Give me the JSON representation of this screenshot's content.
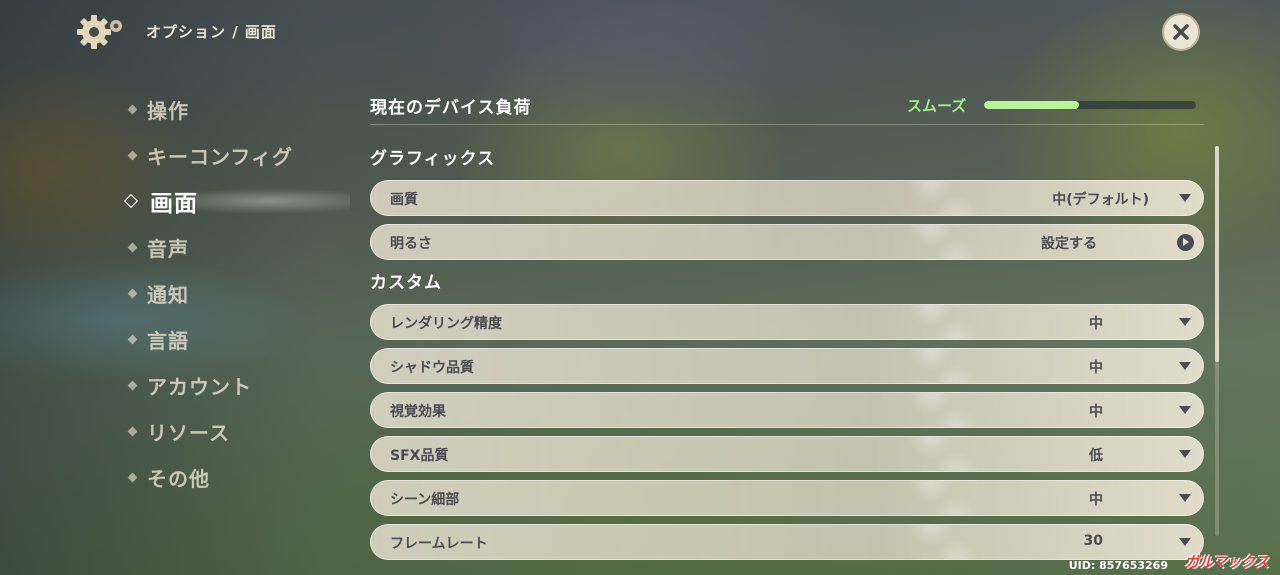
{
  "header": {
    "breadcrumb": "オプション / 画面",
    "gear_icon": "gear-icon",
    "close_icon": "close-icon"
  },
  "sidebar": {
    "items": [
      {
        "label": "操作",
        "active": false
      },
      {
        "label": "キーコンフィグ",
        "active": false
      },
      {
        "label": "画面",
        "active": true
      },
      {
        "label": "音声",
        "active": false
      },
      {
        "label": "通知",
        "active": false
      },
      {
        "label": "言語",
        "active": false
      },
      {
        "label": "アカウント",
        "active": false
      },
      {
        "label": "リソース",
        "active": false
      },
      {
        "label": "その他",
        "active": false
      }
    ]
  },
  "device_load": {
    "title": "現在のデバイス負荷",
    "status": "スムーズ",
    "level_fraction": 0.45,
    "status_color": "#9ef08a"
  },
  "graphics": {
    "title": "グラフィックス",
    "rows": [
      {
        "label": "画質",
        "value": "中(デフォルト)",
        "control": "dropdown"
      },
      {
        "label": "明るさ",
        "value": "設定する",
        "control": "button"
      }
    ]
  },
  "custom": {
    "title": "カスタム",
    "rows": [
      {
        "label": "レンダリング精度",
        "value": "中",
        "control": "dropdown"
      },
      {
        "label": "シャドウ品質",
        "value": "中",
        "control": "dropdown"
      },
      {
        "label": "視覚効果",
        "value": "中",
        "control": "dropdown"
      },
      {
        "label": "SFX品質",
        "value": "低",
        "control": "dropdown"
      },
      {
        "label": "シーン細部",
        "value": "中",
        "control": "dropdown"
      },
      {
        "label": "フレームレート",
        "value": "30",
        "control": "dropdown"
      }
    ]
  },
  "footer": {
    "uid": "UID: 857653269",
    "watermark": "ガルマックス"
  },
  "colors": {
    "text_light": "#ece5d4",
    "row_bg": "#ece5d4",
    "row_text": "#4b4a52",
    "accent_green": "#b8f59a"
  }
}
